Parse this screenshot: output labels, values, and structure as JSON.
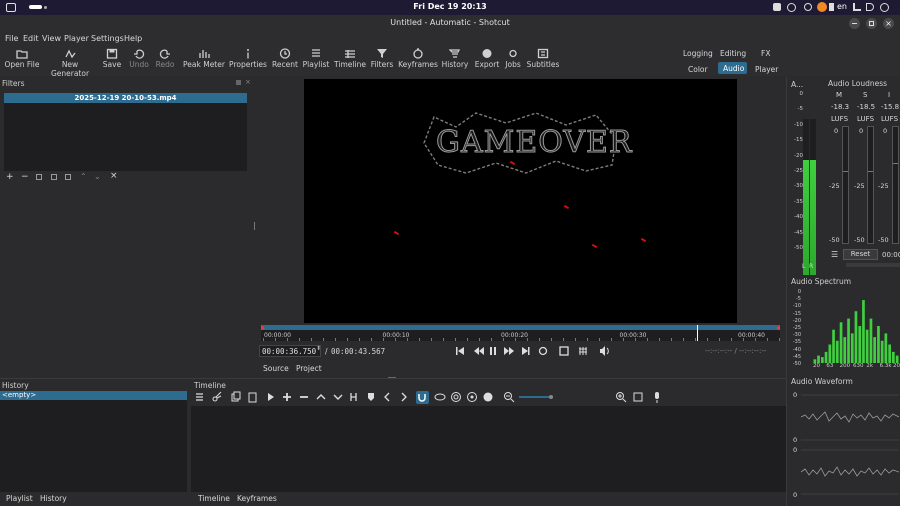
{
  "system_bar": {
    "clock": "Fri Dec 19  20:13",
    "lang": "en"
  },
  "window": {
    "title": "Untitled - Automatic - Shotcut"
  },
  "menu": [
    "File",
    "Edit",
    "View",
    "Player",
    "Settings",
    "Help"
  ],
  "toolbar": {
    "open_file": "Open File",
    "new_generator": "New Generator",
    "save": "Save",
    "undo": "Undo",
    "redo": "Redo",
    "peak_meter": "Peak Meter",
    "properties": "Properties",
    "recent": "Recent",
    "playlist": "Playlist",
    "timeline": "Timeline",
    "filters": "Filters",
    "keyframes": "Keyframes",
    "history": "History",
    "export": "Export",
    "jobs": "Jobs",
    "subtitles": "Subtitles"
  },
  "layouts": {
    "logging": "Logging",
    "editing": "Editing",
    "fx": "FX",
    "color": "Color",
    "audio": "Audio",
    "player": "Player"
  },
  "filters_panel": {
    "title": "Filters",
    "clip_name": "2025-12-19 20-10-53.mp4"
  },
  "player": {
    "video_text": "GAMEOVER",
    "ruler_labels": [
      "00:00:00",
      "00:00:10",
      "00:00:20",
      "00:00:30",
      "00:00:40"
    ],
    "playhead_fraction": 0.84,
    "current_time": "00:00:36.750",
    "separator": "/",
    "total_time": "00:00:43.567",
    "in_out": "--:--:--:--  /  --:--:--:--",
    "tab_source": "Source",
    "tab_project": "Project"
  },
  "history_panel": {
    "title": "History",
    "item": "<empty>",
    "tab_playlist": "Playlist",
    "tab_history": "History"
  },
  "timeline_panel": {
    "title": "Timeline",
    "tab_timeline": "Timeline",
    "tab_keyframes": "Keyframes"
  },
  "audio_meter": {
    "title": "A...",
    "scale": [
      "0",
      "-5",
      "-10",
      "-15",
      "-20",
      "-25",
      "-30",
      "-35",
      "-40",
      "-45",
      "-50"
    ],
    "channels": [
      "L",
      "R"
    ],
    "level_db": -13
  },
  "loudness": {
    "title": "Audio Loudness",
    "headers": [
      "M",
      "S",
      "I"
    ],
    "values": [
      "-18.3",
      "-18.5",
      "-15.8"
    ],
    "units": [
      "LUFS",
      "LUFS",
      "LUFS"
    ],
    "scale_top": "0",
    "scale_mid": "-25",
    "scale_bottom": "-50",
    "reset_label": "Reset",
    "time": "00:00"
  },
  "spectrum": {
    "title": "Audio Spectrum",
    "scale": [
      "0",
      "-5",
      "-10",
      "-15",
      "-20",
      "-25",
      "-30",
      "-35",
      "-40",
      "-45",
      "-50"
    ],
    "freq_labels": [
      "20",
      "63",
      "200",
      "630",
      "2k",
      "6.3k",
      "20k"
    ],
    "bars": [
      0.05,
      0.1,
      0.08,
      0.15,
      0.25,
      0.45,
      0.3,
      0.55,
      0.35,
      0.6,
      0.4,
      0.7,
      0.5,
      0.85,
      0.45,
      0.6,
      0.35,
      0.5,
      0.3,
      0.4,
      0.25,
      0.15,
      0.1
    ]
  },
  "waveform": {
    "title": "Audio Waveform",
    "labels": [
      "0",
      "0",
      "0",
      "0"
    ]
  },
  "colors": {
    "accent": "#2d6b8f",
    "meter_green": "#3fcf3f",
    "playhead": "#ffffff",
    "bg": "#2b2b2d"
  }
}
